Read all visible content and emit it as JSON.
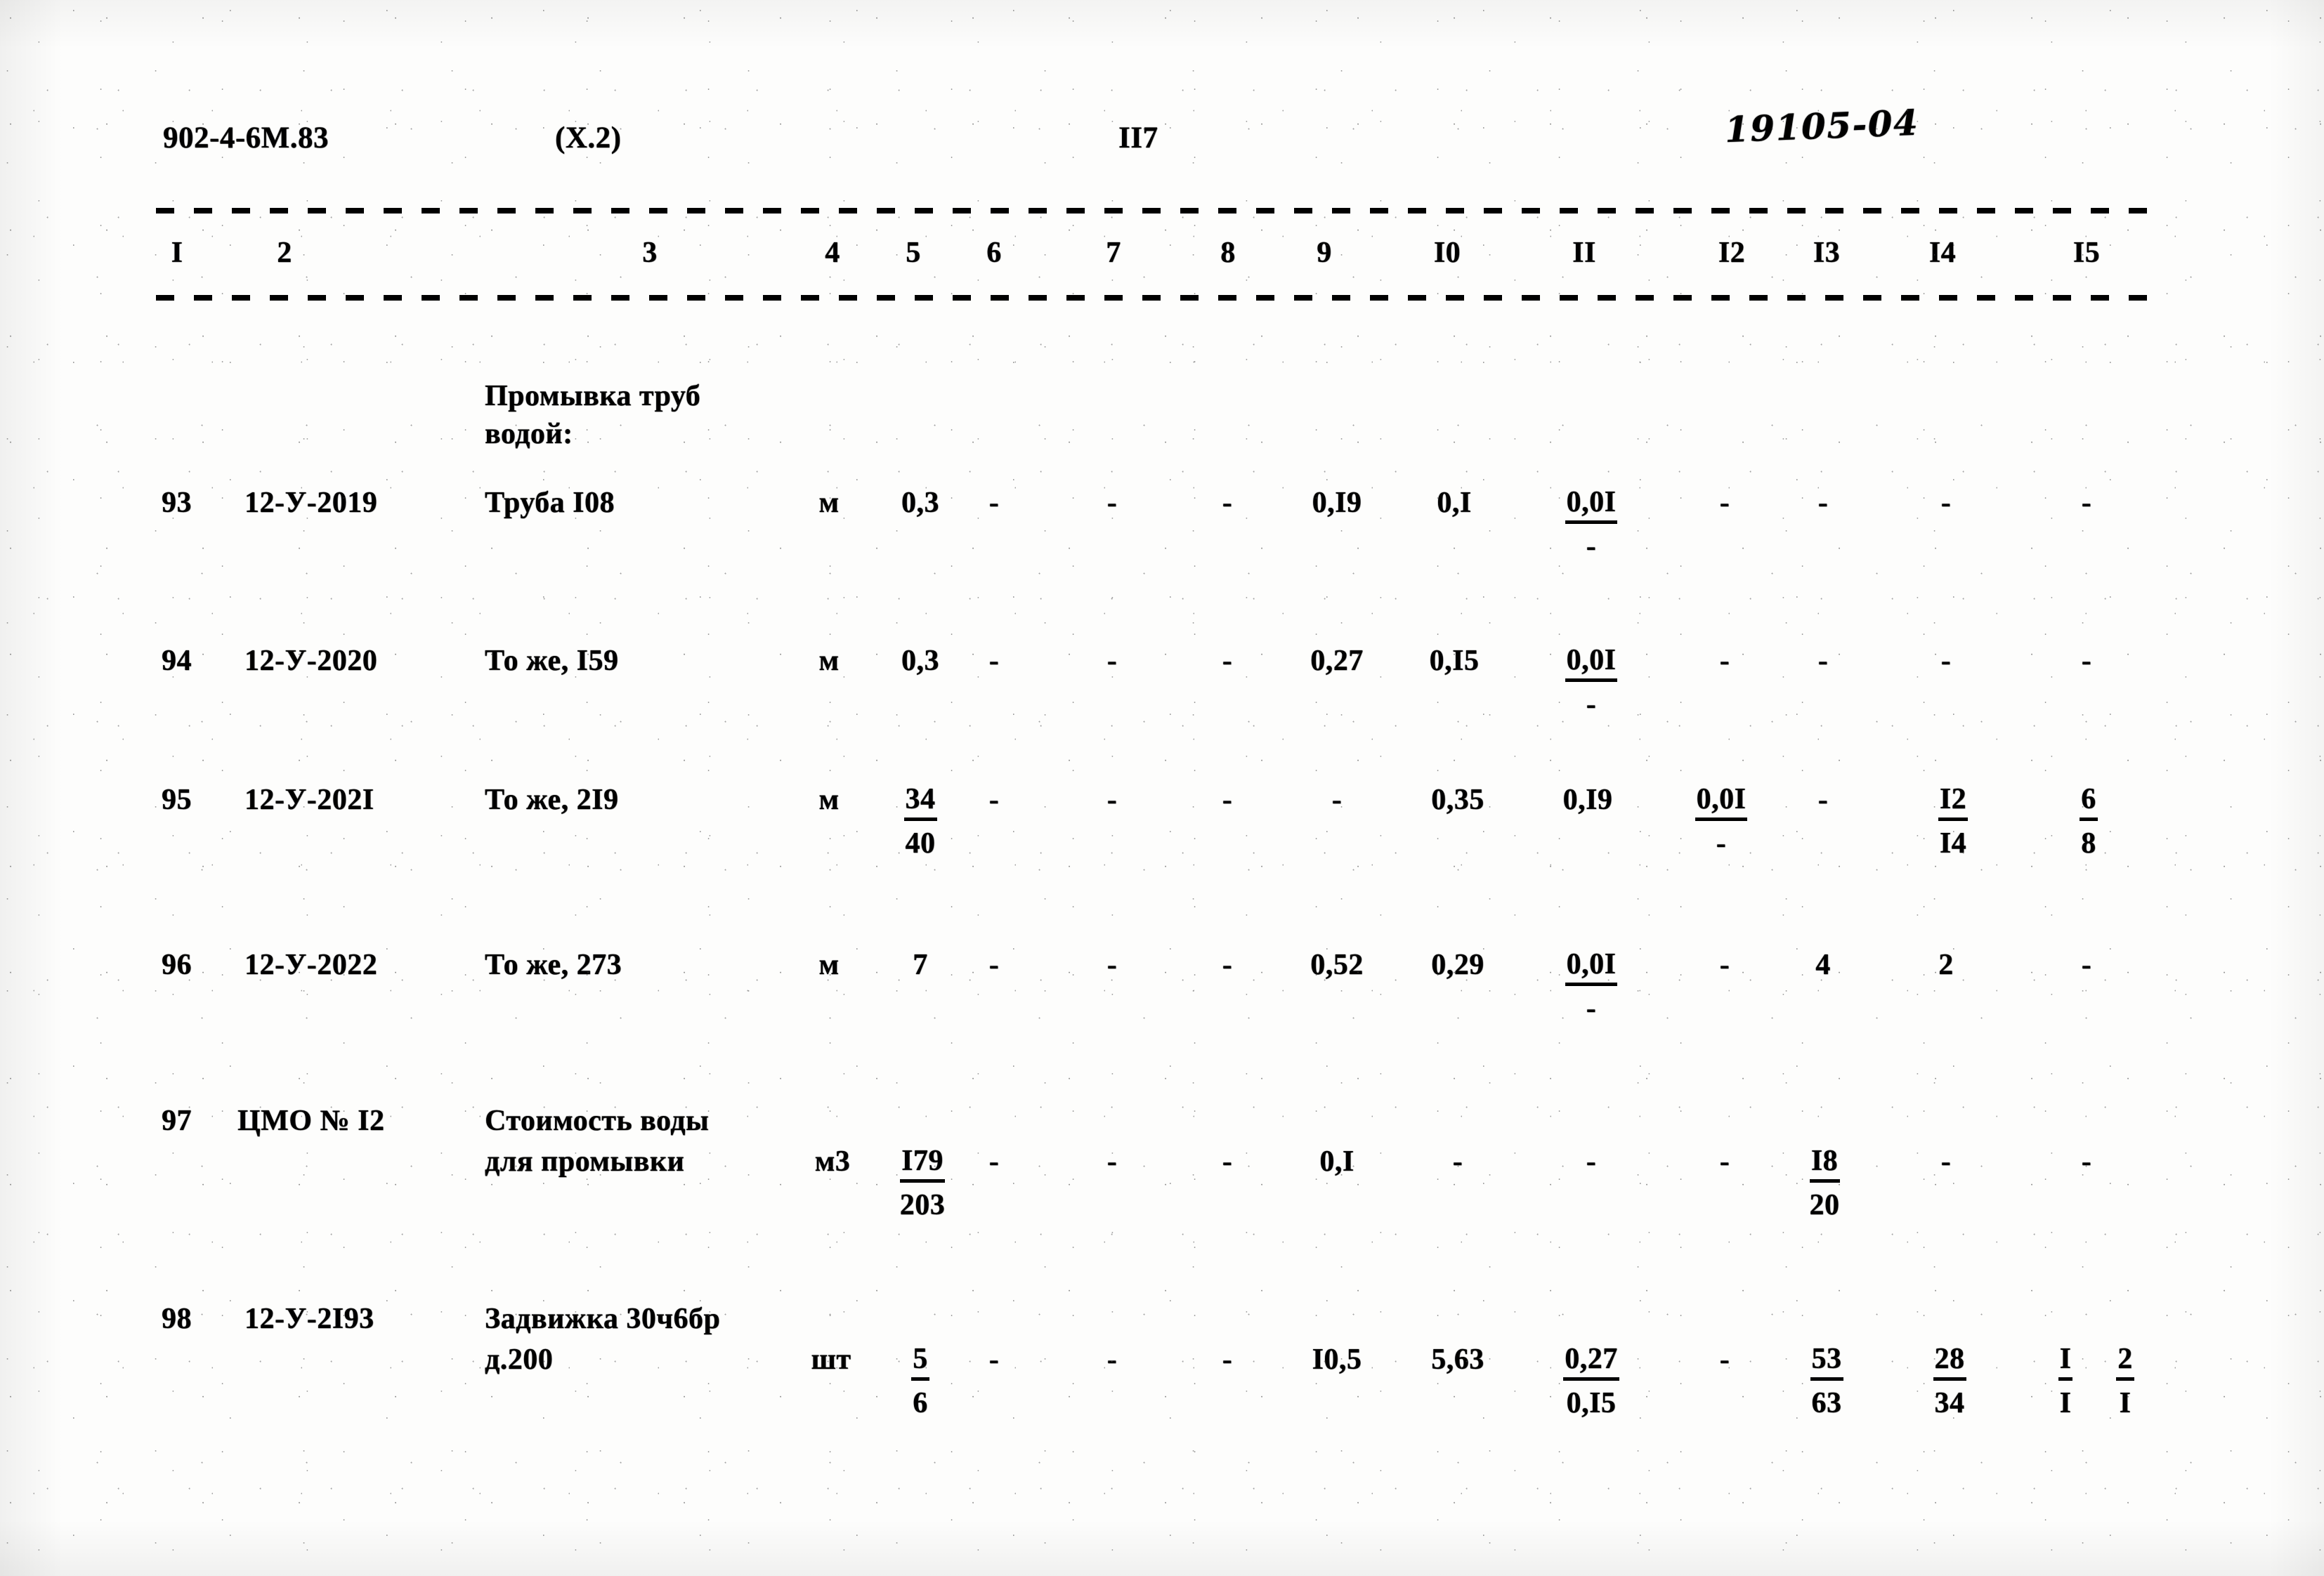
{
  "header": {
    "doc_code": "902-4-6М.83",
    "sheet_ref": "(Х.2)",
    "page_number": "II7",
    "hand_number": "19105-04"
  },
  "table": {
    "column_numbers": [
      "I",
      "2",
      "3",
      "4",
      "5",
      "6",
      "7",
      "8",
      "9",
      "I0",
      "II",
      "I2",
      "I3",
      "I4",
      "I5"
    ],
    "section_heading": {
      "line1": "Промывка труб",
      "line2": "водой:"
    },
    "rows": [
      {
        "num": "93",
        "code": "12-У-2019",
        "name_line1": "Труба I08",
        "name_line2": "",
        "unit": "м",
        "c5_top": "0,3",
        "c5_bot": "",
        "c6": "-",
        "c7": "-",
        "c8": "-",
        "c9_top": "0,I9",
        "c9_bot": "",
        "c10_top": "0,I",
        "c10_bot": "",
        "c11_top": "0,0I",
        "c11_bot": "-",
        "c11_rule": true,
        "c12_top": "-",
        "c12_bot": "",
        "c13_top": "-",
        "c13_bot": "",
        "c14_top": "-",
        "c14_bot": "",
        "c15_top": "-",
        "c15_bot": ""
      },
      {
        "num": "94",
        "code": "12-У-2020",
        "name_line1": "То же, I59",
        "name_line2": "",
        "unit": "м",
        "c5_top": "0,3",
        "c5_bot": "",
        "c6": "-",
        "c7": "-",
        "c8": "-",
        "c9_top": "0,27",
        "c9_bot": "",
        "c10_top": "0,I5",
        "c10_bot": "",
        "c11_top": "0,0I",
        "c11_bot": "-",
        "c11_rule": true,
        "c12_top": "-",
        "c12_bot": "",
        "c13_top": "-",
        "c13_bot": "",
        "c14_top": "-",
        "c14_bot": "",
        "c15_top": "-",
        "c15_bot": ""
      },
      {
        "num": "95",
        "code": "12-У-202I",
        "name_line1": "То же, 2I9",
        "name_line2": "",
        "unit": "м",
        "c5_top": "34",
        "c5_bot": "40",
        "c5_rule": true,
        "c6": "-",
        "c7": "-",
        "c8": "-",
        "c9_top": "-",
        "c9_bot": "",
        "c10_top": "0,35",
        "c10_bot": "",
        "c11_top": "0,I9",
        "c11_bot": "",
        "c12_top": "0,0I",
        "c12_bot": "-",
        "c12_rule": true,
        "c13_top": "-",
        "c13_bot": "",
        "c14_top": "I2",
        "c14_bot": "I4",
        "c14_rule": true,
        "c15_top": "6",
        "c15_bot": "8",
        "c15_rule": true
      },
      {
        "num": "96",
        "code": "12-У-2022",
        "name_line1": "То же, 273",
        "name_line2": "",
        "unit": "м",
        "c5_top": "7",
        "c5_bot": "",
        "c6": "-",
        "c7": "-",
        "c8": "-",
        "c9_top": "0,52",
        "c9_bot": "",
        "c10_top": "0,29",
        "c10_bot": "",
        "c11_top": "0,0I",
        "c11_bot": "-",
        "c11_rule": true,
        "c12_top": "-",
        "c12_bot": "",
        "c13_top": "4",
        "c13_bot": "",
        "c14_top": "2",
        "c14_bot": "",
        "c15_top": "-",
        "c15_bot": ""
      },
      {
        "num": "97",
        "code": "ЦМО № I2",
        "name_line1": "Стоимость воды",
        "name_line2": "для промывки",
        "unit": "м3",
        "c5_top": "I79",
        "c5_bot": "203",
        "c5_rule": true,
        "c6": "-",
        "c7": "-",
        "c8": "-",
        "c9_top": "0,I",
        "c9_bot": "",
        "c10_top": "-",
        "c10_bot": "",
        "c11_top": "-",
        "c11_bot": "",
        "c12_top": "-",
        "c12_bot": "",
        "c13_top": "I8",
        "c13_bot": "20",
        "c13_rule": true,
        "c14_top": "-",
        "c14_bot": "",
        "c15_top": "-",
        "c15_bot": ""
      },
      {
        "num": "98",
        "code": "12-У-2I93",
        "name_line1": "Задвижка 30ч6бр",
        "name_line2": "д.200",
        "unit": "шт",
        "c5_top": "5",
        "c5_bot": "6",
        "c5_rule": true,
        "c6": "-",
        "c7": "-",
        "c8": "-",
        "c9_top": "I0,5",
        "c9_bot": "",
        "c10_top": "5,63",
        "c10_bot": "",
        "c11_top": "0,27",
        "c11_bot": "0,I5",
        "c11_rule": true,
        "c12_top": "-",
        "c12_bot": "",
        "c13_top": "53",
        "c13_bot": "63",
        "c13_rule": true,
        "c14_top": "28",
        "c14_bot": "34",
        "c14_rule": true,
        "c15_top": "I",
        "c15_bot": "I",
        "c15_rule": true,
        "c16_top": "2",
        "c16_bot": "I",
        "c16_rule": true
      }
    ]
  }
}
